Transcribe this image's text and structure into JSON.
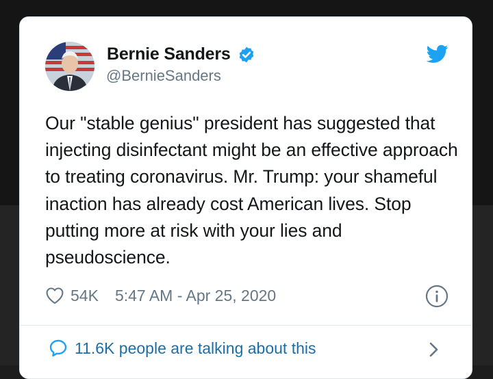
{
  "author": {
    "name": "Bernie Sanders",
    "handle": "@BernieSanders"
  },
  "tweet": {
    "text": "Our \"stable genius\" president has suggested that injecting disinfectant might be an effective approach to treating coronavirus. Mr. Trump: your shameful inaction has already cost American lives. Stop putting more at risk with your lies and pseudoscience.",
    "likes": "54K",
    "timestamp": "5:47 AM - Apr 25, 2020"
  },
  "footer": {
    "talking_text": "11.6K people are talking about this"
  },
  "icons": {
    "verified": "verified-badge-icon",
    "brand": "twitter-bird-icon",
    "like": "heart-icon",
    "info": "info-icon",
    "conversation": "speech-bubble-icon",
    "chevron": "chevron-right-icon"
  },
  "colors": {
    "twitter_blue": "#1da1f2",
    "text": "#14171a",
    "secondary": "#657786",
    "link": "#1b6ea8"
  }
}
